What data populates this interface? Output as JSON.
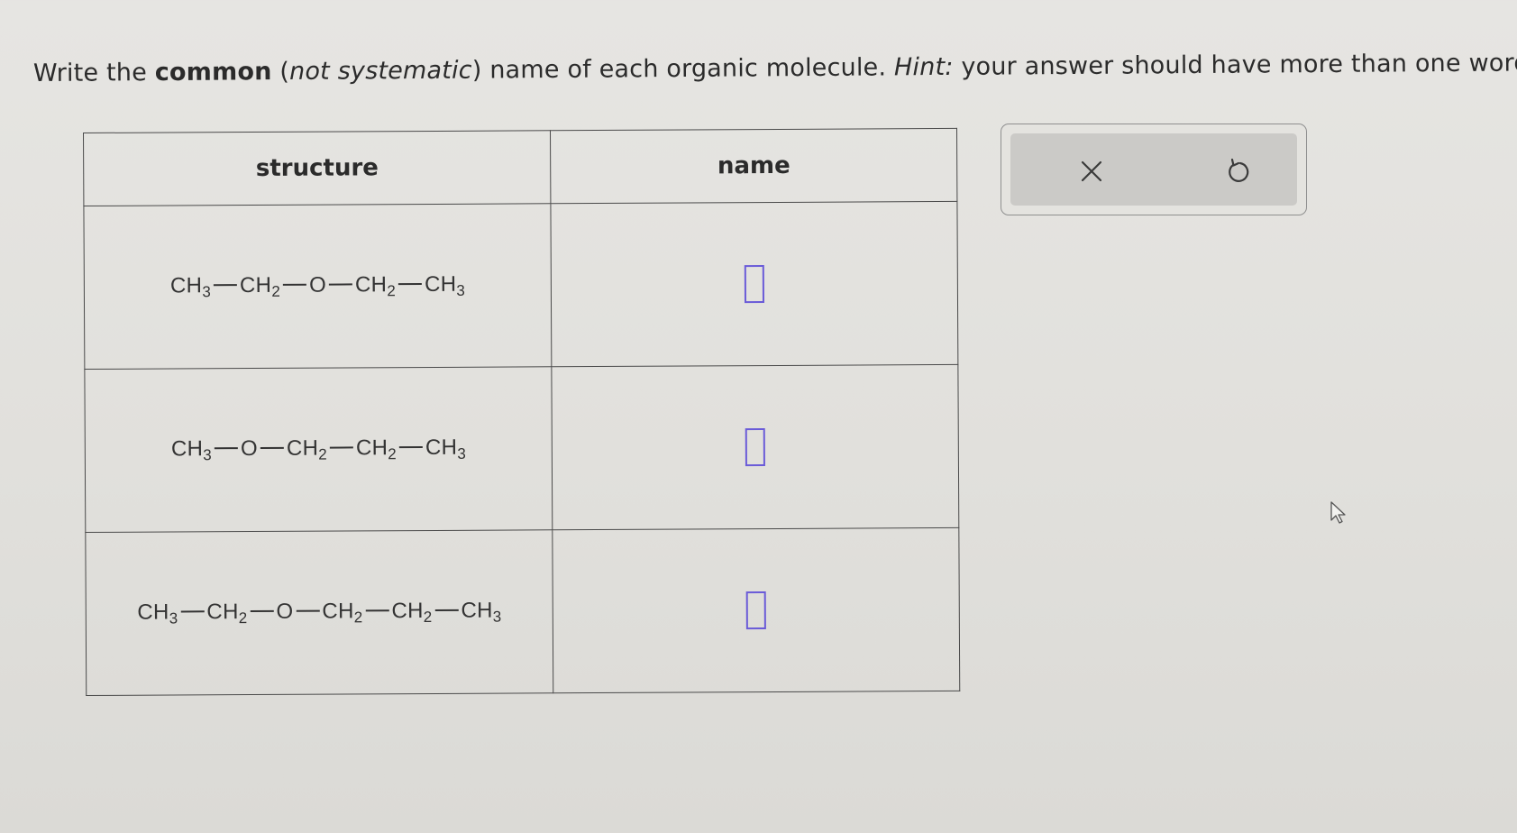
{
  "prompt": {
    "part1": "Write the ",
    "bold": "common",
    "part2": " (",
    "italic1": "not systematic",
    "part3": ") name of each organic molecule. ",
    "italic2": "Hint:",
    "part4": " your answer should have more than one word."
  },
  "table": {
    "headers": {
      "structure": "structure",
      "name": "name"
    },
    "rows": [
      {
        "groups": [
          {
            "base": "CH",
            "sub": "3"
          },
          {
            "base": "CH",
            "sub": "2"
          },
          {
            "base": "O",
            "sub": ""
          },
          {
            "base": "CH",
            "sub": "2"
          },
          {
            "base": "CH",
            "sub": "3"
          }
        ],
        "answer": ""
      },
      {
        "groups": [
          {
            "base": "CH",
            "sub": "3"
          },
          {
            "base": "O",
            "sub": ""
          },
          {
            "base": "CH",
            "sub": "2"
          },
          {
            "base": "CH",
            "sub": "2"
          },
          {
            "base": "CH",
            "sub": "3"
          }
        ],
        "answer": ""
      },
      {
        "groups": [
          {
            "base": "CH",
            "sub": "3"
          },
          {
            "base": "CH",
            "sub": "2"
          },
          {
            "base": "O",
            "sub": ""
          },
          {
            "base": "CH",
            "sub": "2"
          },
          {
            "base": "CH",
            "sub": "2"
          },
          {
            "base": "CH",
            "sub": "3"
          }
        ],
        "answer": ""
      }
    ]
  },
  "toolbox": {
    "clear_icon": "close-icon",
    "undo_icon": "undo-icon"
  },
  "colors": {
    "answer_box_border": "#6a5bd8",
    "background": "#e3e2df"
  }
}
